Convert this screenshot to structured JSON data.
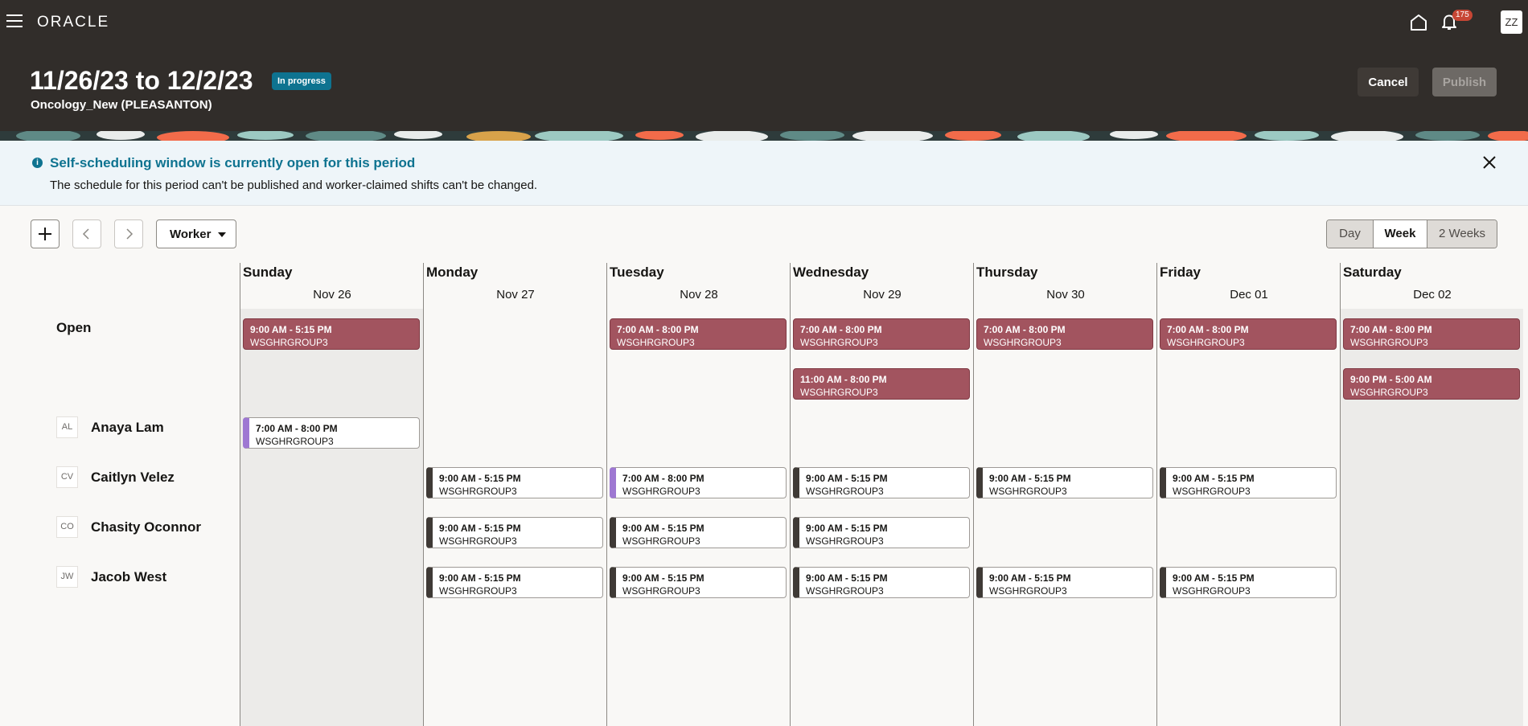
{
  "app": {
    "logo": "ORACLE",
    "notifications_count": "175",
    "user_initials": "ZZ"
  },
  "header": {
    "title": "11/26/23 to 12/2/23",
    "status": "In progress",
    "subtitle": "Oncology_New (PLEASANTON)",
    "cancel_label": "Cancel",
    "publish_label": "Publish"
  },
  "message": {
    "title": "Self-scheduling window is currently open for this period",
    "body": "The schedule for this period can't be published and worker-claimed shifts can't be changed."
  },
  "toolbar": {
    "view_by": "Worker",
    "views": [
      "Day",
      "Week",
      "2 Weeks"
    ],
    "selected_view": "Week"
  },
  "days": [
    {
      "name": "Sunday",
      "date": "Nov 26"
    },
    {
      "name": "Monday",
      "date": "Nov 27"
    },
    {
      "name": "Tuesday",
      "date": "Nov 28"
    },
    {
      "name": "Wednesday",
      "date": "Nov 29"
    },
    {
      "name": "Thursday",
      "date": "Nov 30"
    },
    {
      "name": "Friday",
      "date": "Dec 01"
    },
    {
      "name": "Saturday",
      "date": "Dec 02"
    }
  ],
  "rows": {
    "open_label": "Open",
    "workers": [
      {
        "initials": "AL",
        "name": "Anaya Lam"
      },
      {
        "initials": "CV",
        "name": "Caitlyn Velez"
      },
      {
        "initials": "CO",
        "name": "Chasity Oconnor"
      },
      {
        "initials": "JW",
        "name": "Jacob West"
      }
    ]
  },
  "shifts": {
    "open": [
      {
        "time": "9:00 AM - 5:15 PM",
        "group": "WSGHRGROUP3"
      },
      {
        "time": "7:00 AM - 8:00 PM",
        "group": "WSGHRGROUP3"
      },
      {
        "time": "7:00 AM - 8:00 PM",
        "group": "WSGHRGROUP3"
      },
      {
        "time": "11:00 AM - 8:00 PM",
        "group": "WSGHRGROUP3"
      },
      {
        "time": "7:00 AM - 8:00 PM",
        "group": "WSGHRGROUP3"
      },
      {
        "time": "7:00 AM - 8:00 PM",
        "group": "WSGHRGROUP3"
      },
      {
        "time": "7:00 AM - 8:00 PM",
        "group": "WSGHRGROUP3"
      },
      {
        "time": "9:00 PM - 5:00 AM",
        "group": "WSGHRGROUP3"
      }
    ],
    "anaya": [
      {
        "time": "7:00 AM - 8:00 PM",
        "group": "WSGHRGROUP3"
      }
    ],
    "caitlyn": [
      {
        "time": "9:00 AM - 5:15 PM",
        "group": "WSGHRGROUP3"
      },
      {
        "time": "7:00 AM - 8:00 PM",
        "group": "WSGHRGROUP3"
      },
      {
        "time": "9:00 AM - 5:15 PM",
        "group": "WSGHRGROUP3"
      },
      {
        "time": "9:00 AM - 5:15 PM",
        "group": "WSGHRGROUP3"
      },
      {
        "time": "9:00 AM - 5:15 PM",
        "group": "WSGHRGROUP3"
      }
    ],
    "chasity": [
      {
        "time": "9:00 AM - 5:15 PM",
        "group": "WSGHRGROUP3"
      },
      {
        "time": "9:00 AM - 5:15 PM",
        "group": "WSGHRGROUP3"
      },
      {
        "time": "9:00 AM - 5:15 PM",
        "group": "WSGHRGROUP3"
      }
    ],
    "jacob": [
      {
        "time": "9:00 AM - 5:15 PM",
        "group": "WSGHRGROUP3"
      },
      {
        "time": "9:00 AM - 5:15 PM",
        "group": "WSGHRGROUP3"
      },
      {
        "time": "9:00 AM - 5:15 PM",
        "group": "WSGHRGROUP3"
      },
      {
        "time": "9:00 AM - 5:15 PM",
        "group": "WSGHRGROUP3"
      },
      {
        "time": "9:00 AM - 5:15 PM",
        "group": "WSGHRGROUP3"
      }
    ]
  },
  "colors": {
    "header_bg": "#312d2a",
    "open_shift": "#a2545f",
    "claimed_marker": "#9e78d2",
    "assigned_marker": "#3f3a36",
    "info": "#0e7390"
  }
}
